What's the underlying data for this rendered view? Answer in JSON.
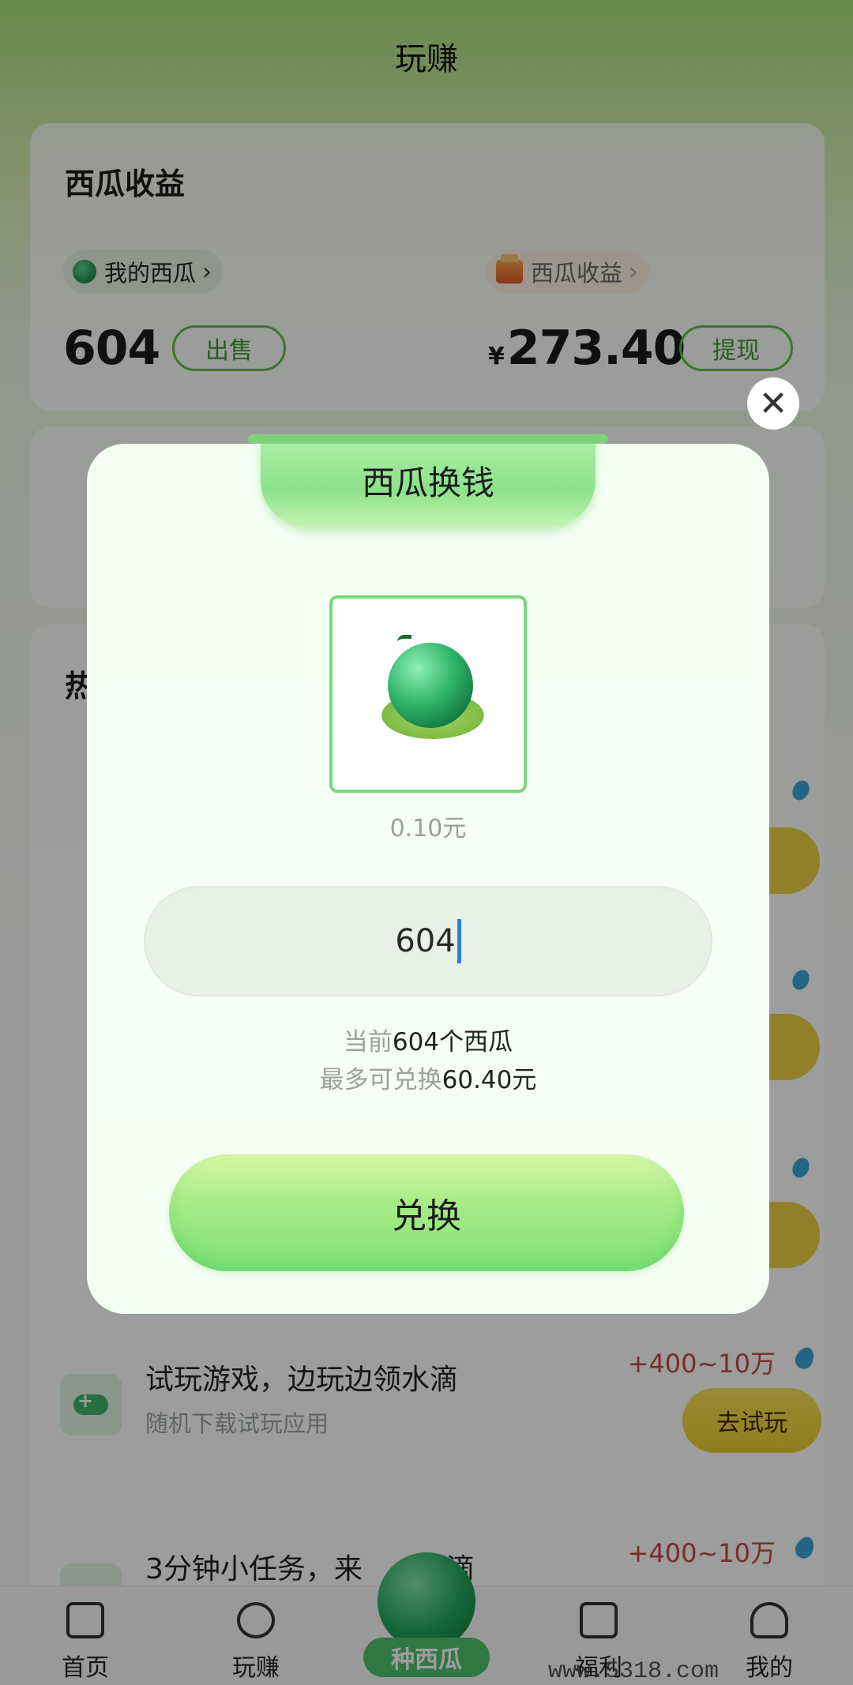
{
  "header": {
    "title": "玩赚"
  },
  "earnings": {
    "title": "西瓜收益",
    "my_melons_label": "我的西瓜",
    "melon_income_label": "西瓜收益",
    "chevron": "›",
    "melon_count": "604",
    "sell_label": "出售",
    "currency_symbol": "¥",
    "income_amount": "273.40",
    "withdraw_label": "提现"
  },
  "hot_section": {
    "title_partial": "热"
  },
  "tasks": [
    {
      "title": "试玩游戏，边玩边领水滴",
      "subtitle": "随机下载试玩应用",
      "reward": "+400~10万",
      "button": "去试玩",
      "icon": "gamepad-icon"
    },
    {
      "title": "3分钟小任务，来",
      "title_tail": "水滴",
      "reward": "+400~10万"
    }
  ],
  "modal": {
    "title": "西瓜换钱",
    "unit_price": "0.10元",
    "input_value": "604",
    "current_prefix": "当前",
    "current_count": "604个西瓜",
    "max_prefix": "最多可兑换",
    "max_amount": "60.40元",
    "exchange_label": "兑换",
    "close_icon": "✕"
  },
  "bottom_nav": {
    "home": "首页",
    "play": "玩赚",
    "center": "种西瓜",
    "gift": "福利",
    "me": "我的"
  },
  "watermark": "www.5318.com",
  "colors": {
    "accent_green": "#5ebd4a",
    "reward_red": "#c0474a",
    "button_yellow": "#e8c92c",
    "input_caret": "#2f7de0"
  }
}
